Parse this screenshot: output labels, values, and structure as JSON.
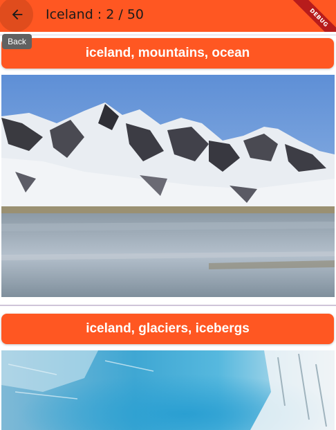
{
  "appbar": {
    "title": "Iceland : 2 / 50",
    "back_icon": "arrow-back-icon",
    "background_color": "#ff5722",
    "debug_banner": "DEBUG"
  },
  "tooltip": {
    "text": "Back"
  },
  "cards": [
    {
      "caption": "iceland, mountains, ocean",
      "image": "mountains-lake-photo"
    },
    {
      "caption": "iceland, glaciers, icebergs",
      "image": "glacier-ice-photo"
    }
  ]
}
